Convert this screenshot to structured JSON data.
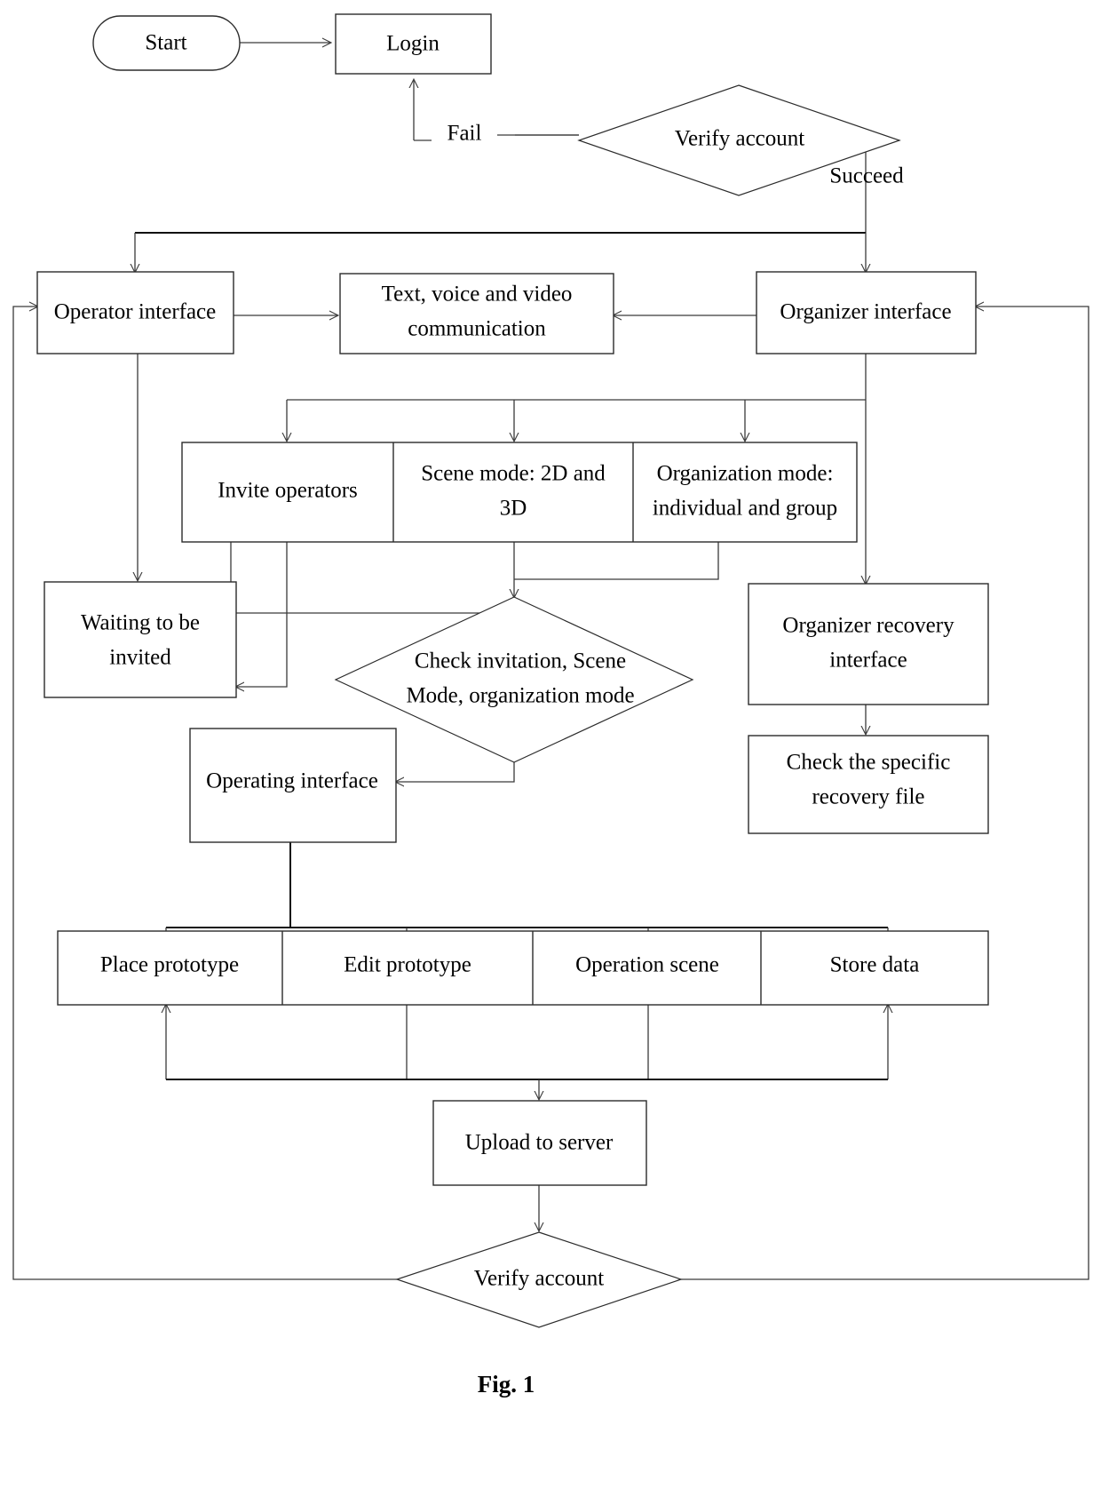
{
  "figure": {
    "caption": "Fig. 1"
  },
  "nodes": {
    "start": {
      "label": "Start",
      "shape": "stadium"
    },
    "login": {
      "label": "Login",
      "shape": "rect"
    },
    "verify_account_top": {
      "label": "Verify account",
      "shape": "diamond"
    },
    "operator_interface": {
      "label": "Operator interface",
      "shape": "rect"
    },
    "communication": {
      "line1": "Text, voice and video",
      "line2": "communication",
      "shape": "rect"
    },
    "organizer_interface": {
      "label": "Organizer interface",
      "shape": "rect"
    },
    "invite_operators": {
      "label": "Invite operators",
      "shape": "rect"
    },
    "scene_mode": {
      "line1": "Scene mode: 2D and",
      "line2": "3D",
      "shape": "rect"
    },
    "organization_mode": {
      "line1": "Organization mode:",
      "line2": "individual and group",
      "shape": "rect"
    },
    "waiting_to_be_invited": {
      "line1": "Waiting to be",
      "line2": "invited",
      "shape": "rect"
    },
    "check_invitation": {
      "line1": "Check invitation, Scene",
      "line2": "Mode, organization mode",
      "shape": "diamond"
    },
    "organizer_recovery": {
      "line1": "Organizer recovery",
      "line2": "interface",
      "shape": "rect"
    },
    "check_recovery_file": {
      "line1": "Check the specific",
      "line2": "recovery file",
      "shape": "rect"
    },
    "operating_interface": {
      "label": "Operating interface",
      "shape": "rect"
    },
    "place_prototype": {
      "label": "Place prototype",
      "shape": "rect"
    },
    "edit_prototype": {
      "label": "Edit prototype",
      "shape": "rect"
    },
    "operation_scene": {
      "label": "Operation scene",
      "shape": "rect"
    },
    "store_data": {
      "label": "Store data",
      "shape": "rect"
    },
    "upload_to_server": {
      "label": "Upload to server",
      "shape": "rect"
    },
    "verify_account_bottom": {
      "label": "Verify account",
      "shape": "diamond"
    }
  },
  "edge_labels": {
    "fail": "Fail",
    "succeed": "Succeed"
  },
  "colors": {
    "background": "#ffffff",
    "stroke": "#2b2b2b",
    "connector": "#3a3a3a",
    "connector_bold": "#111111",
    "text": "#000000"
  }
}
